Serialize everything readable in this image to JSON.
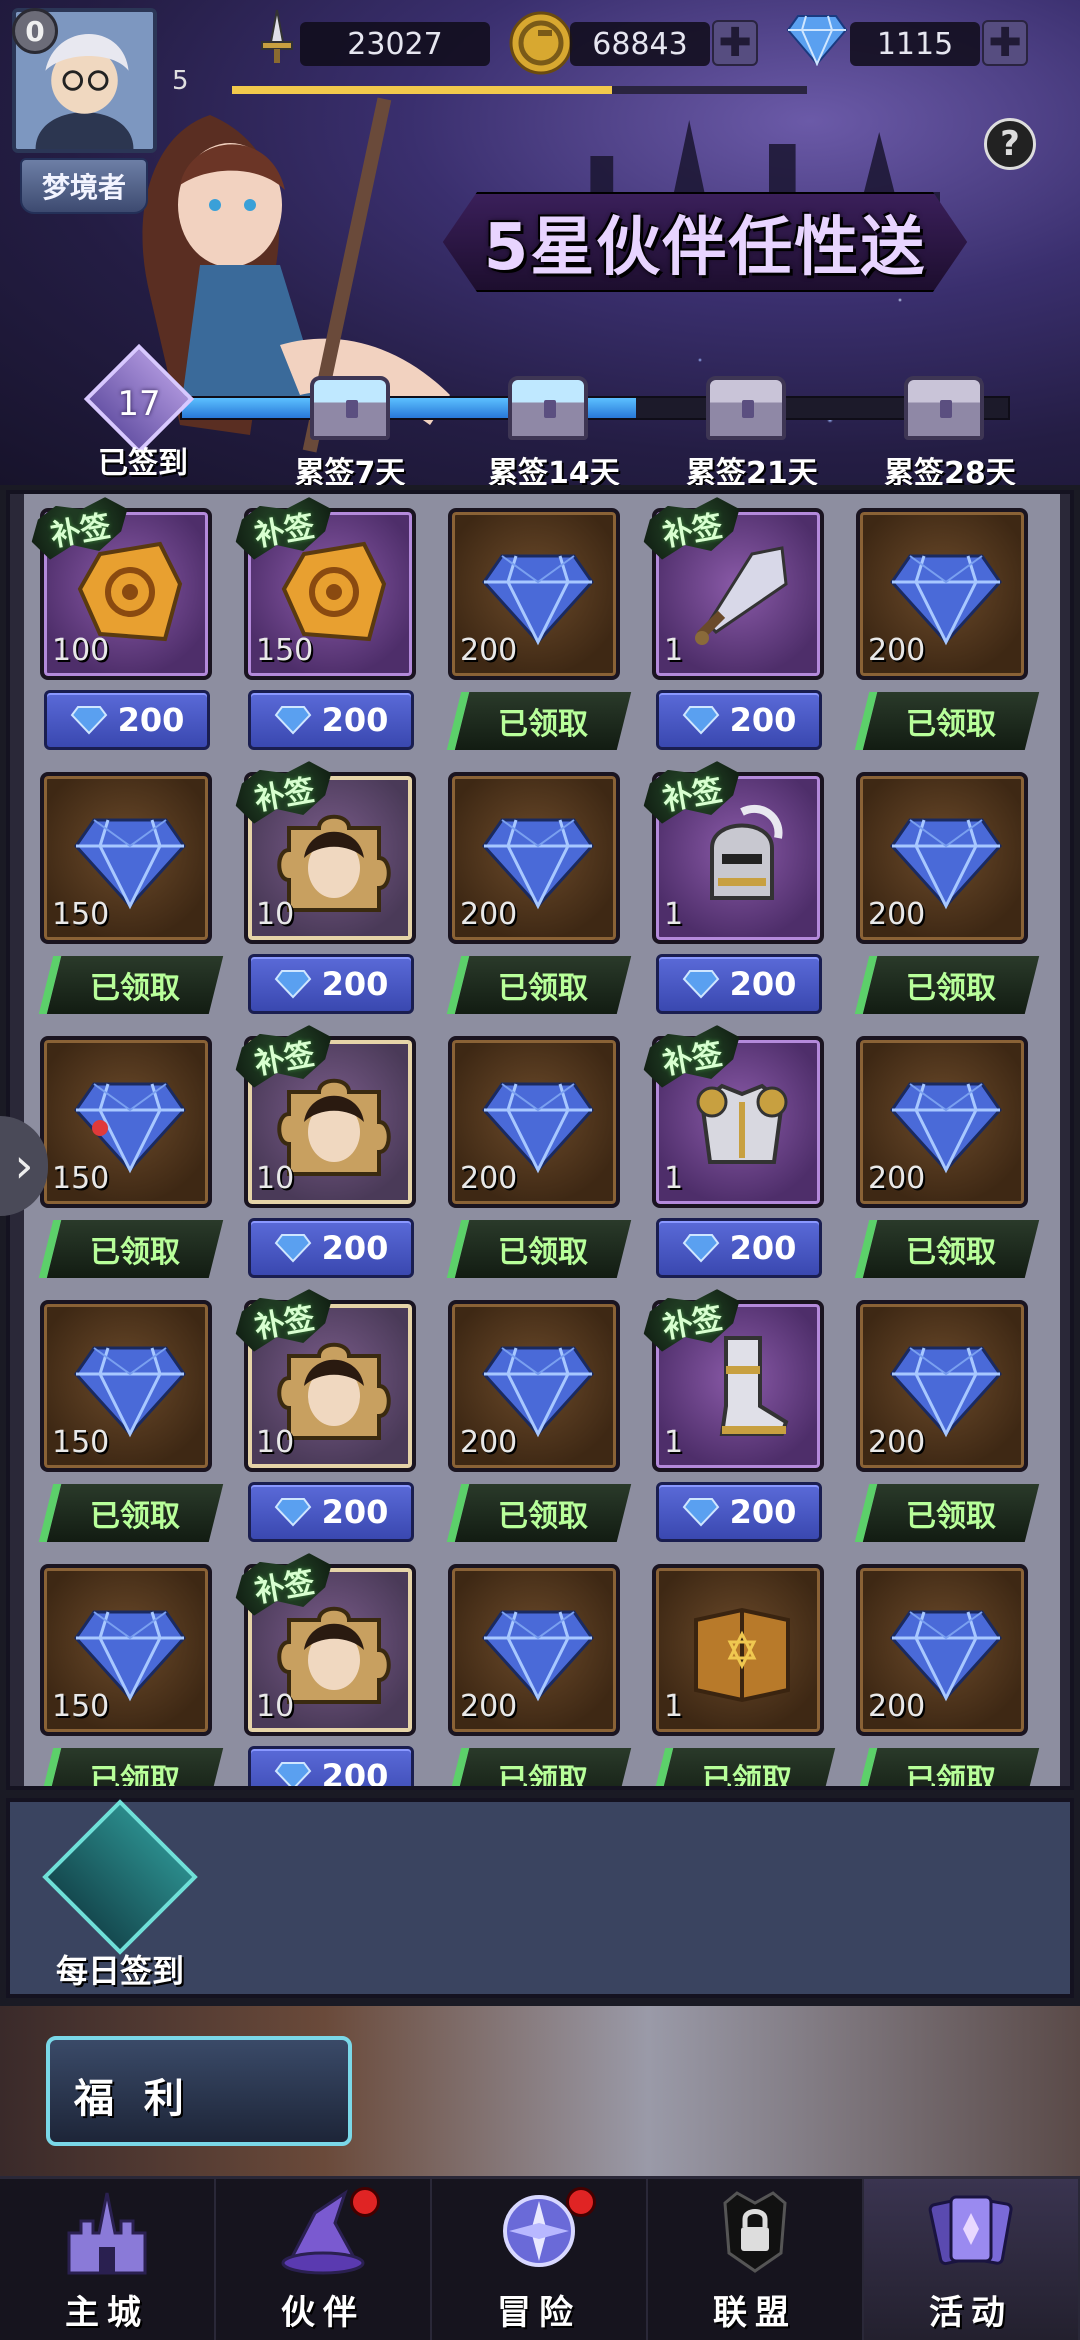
{
  "header": {
    "avatar_level": "0",
    "player_level": "5",
    "player_tag": "梦境者",
    "exp_fraction": 0.66,
    "power": "23027",
    "gold": "68843",
    "diamonds": "1115",
    "help_icon": "question-icon"
  },
  "event": {
    "title": "5星伙伴任性送",
    "signed_days": "17",
    "signed_label": "已签到",
    "progress_fraction": 0.55,
    "milestones": [
      {
        "label": "累签7天",
        "opened": true
      },
      {
        "label": "累签14天",
        "opened": true
      },
      {
        "label": "累签21天",
        "opened": false
      },
      {
        "label": "累签28天",
        "opened": false
      }
    ]
  },
  "labels": {
    "makeup": "补签",
    "claimed": "已领取",
    "cost": "200"
  },
  "grid": [
    [
      {
        "type": "rune",
        "style": "purple",
        "qty": "100",
        "makeup": true,
        "action": "cost"
      },
      {
        "type": "rune",
        "style": "purple",
        "qty": "150",
        "makeup": true,
        "action": "cost"
      },
      {
        "type": "diamond",
        "style": "brown",
        "qty": "200",
        "makeup": false,
        "action": "claimed"
      },
      {
        "type": "sword",
        "style": "purple",
        "qty": "1",
        "makeup": true,
        "action": "cost"
      },
      {
        "type": "diamond",
        "style": "brown",
        "qty": "200",
        "makeup": false,
        "action": "claimed"
      }
    ],
    [
      {
        "type": "diamond",
        "style": "brown",
        "qty": "150",
        "makeup": false,
        "action": "claimed"
      },
      {
        "type": "puzzle",
        "style": "gold",
        "qty": "10",
        "makeup": true,
        "action": "cost"
      },
      {
        "type": "diamond",
        "style": "brown",
        "qty": "200",
        "makeup": false,
        "action": "claimed"
      },
      {
        "type": "helmet",
        "style": "purple",
        "qty": "1",
        "makeup": true,
        "action": "cost"
      },
      {
        "type": "diamond",
        "style": "brown",
        "qty": "200",
        "makeup": false,
        "action": "claimed"
      }
    ],
    [
      {
        "type": "diamond",
        "style": "brown",
        "qty": "150",
        "makeup": false,
        "action": "claimed"
      },
      {
        "type": "puzzle",
        "style": "gold",
        "qty": "10",
        "makeup": true,
        "action": "cost"
      },
      {
        "type": "diamond",
        "style": "brown",
        "qty": "200",
        "makeup": false,
        "action": "claimed"
      },
      {
        "type": "armor",
        "style": "purple",
        "qty": "1",
        "makeup": true,
        "action": "cost"
      },
      {
        "type": "diamond",
        "style": "brown",
        "qty": "200",
        "makeup": false,
        "action": "claimed"
      }
    ],
    [
      {
        "type": "diamond",
        "style": "brown",
        "qty": "150",
        "makeup": false,
        "action": "claimed"
      },
      {
        "type": "puzzle",
        "style": "gold",
        "qty": "10",
        "makeup": true,
        "action": "cost"
      },
      {
        "type": "diamond",
        "style": "brown",
        "qty": "200",
        "makeup": false,
        "action": "claimed"
      },
      {
        "type": "boots",
        "style": "purple",
        "qty": "1",
        "makeup": true,
        "action": "cost"
      },
      {
        "type": "diamond",
        "style": "brown",
        "qty": "200",
        "makeup": false,
        "action": "claimed"
      }
    ],
    [
      {
        "type": "diamond",
        "style": "brown",
        "qty": "150",
        "makeup": false,
        "action": "claimed"
      },
      {
        "type": "puzzle",
        "style": "gold",
        "qty": "10",
        "makeup": true,
        "action": "cost"
      },
      {
        "type": "diamond",
        "style": "brown",
        "qty": "200",
        "makeup": false,
        "action": "claimed"
      },
      {
        "type": "book",
        "style": "brown",
        "qty": "1",
        "makeup": false,
        "action": "claimed"
      },
      {
        "type": "diamond",
        "style": "brown",
        "qty": "200",
        "makeup": false,
        "action": "claimed"
      }
    ]
  ],
  "function_bar": {
    "daily_signin_label": "每日签到"
  },
  "welfare": {
    "label": "福 利"
  },
  "nav": [
    {
      "label": "主城",
      "icon": "castle-icon",
      "dot": false,
      "active": false
    },
    {
      "label": "伙伴",
      "icon": "wizard-hat-icon",
      "dot": true,
      "active": false
    },
    {
      "label": "冒险",
      "icon": "compass-orb-icon",
      "dot": true,
      "active": false
    },
    {
      "label": "联盟",
      "icon": "lock-shield-icon",
      "dot": false,
      "active": false
    },
    {
      "label": "活动",
      "icon": "cards-icon",
      "dot": false,
      "active": true
    }
  ],
  "colors": {
    "cost_button": "#3a48b0",
    "claimed_button": "#5cd06a",
    "progress": "#2878d8"
  }
}
